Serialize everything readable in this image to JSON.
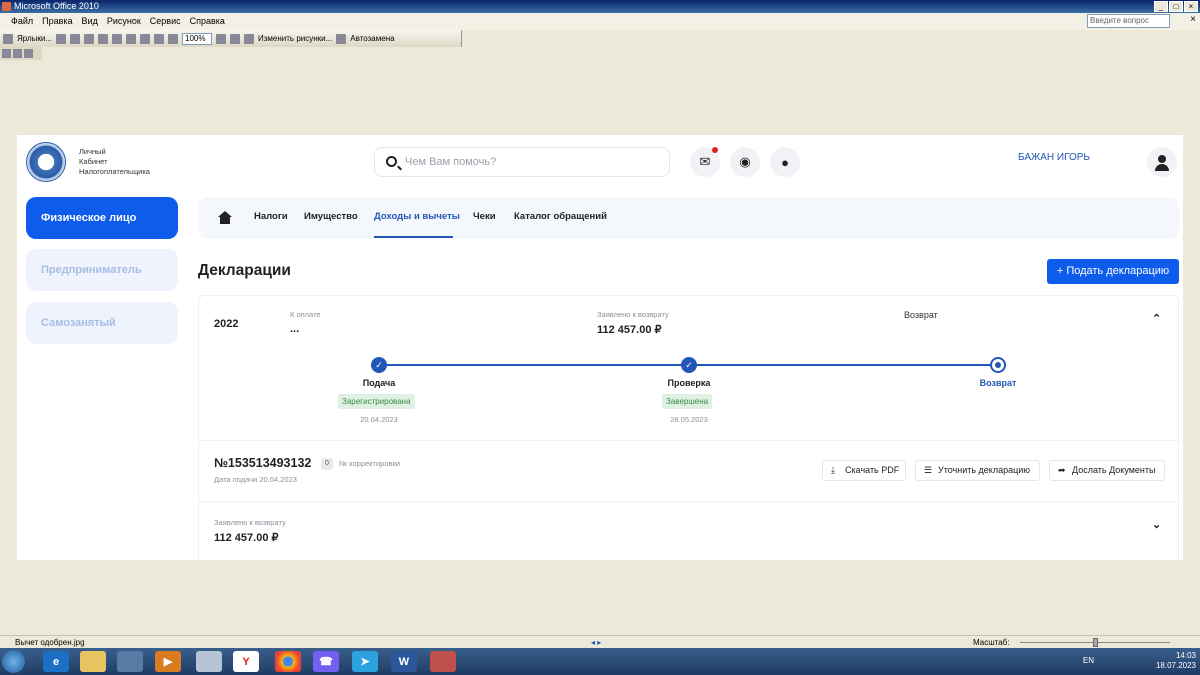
{
  "window": {
    "title": "Microsoft Office 2010",
    "ask_placeholder": "Введите вопрос"
  },
  "menu": [
    "Файл",
    "Правка",
    "Вид",
    "Рисунок",
    "Сервис",
    "Справка"
  ],
  "toolbar": {
    "shortcut_label": "Ярлыки...",
    "zoom": "100%",
    "edit_image_label": "Изменить рисунки...",
    "autoreplace_label": "Автозамена"
  },
  "site": {
    "brand_lines": [
      "Личный",
      "Кабинет",
      "Налогоплательщика"
    ],
    "search_placeholder": "Чем Вам помочь?",
    "user_name": "БАЖАН ИГОРЬ",
    "icons": [
      "mail-icon",
      "eye-off-icon",
      "bulb-icon",
      "user-icon",
      "search-icon",
      "home-icon"
    ]
  },
  "sidebar": {
    "items": [
      {
        "label": "Физическое лицо",
        "active": true
      },
      {
        "label": "Предприниматель",
        "active": false
      },
      {
        "label": "Самозанятый",
        "active": false
      }
    ]
  },
  "nav": {
    "tabs": [
      "Налоги",
      "Имущество",
      "Доходы и вычеты",
      "Чеки",
      "Каталог обращений"
    ],
    "active": "Доходы и вычеты"
  },
  "page": {
    "title": "Декларации",
    "submit_button": "Подать декларацию"
  },
  "declaration": {
    "year": "2022",
    "pay_label": "К оплате",
    "pay_value": "...",
    "claimed_label": "Заявлено к возврату",
    "claimed_value": "112 457.00 ₽",
    "refund_label": "Возврат",
    "steps": [
      {
        "name": "Подача",
        "status": "Зарегистрирована",
        "date": "20.04.2023"
      },
      {
        "name": "Проверка",
        "status": "Завершена",
        "date": "28.05.2023"
      },
      {
        "name": "Возврат",
        "status": "",
        "date": ""
      }
    ],
    "number": "№153513493132",
    "correction_count": "0",
    "correction_label": "№ корректировки",
    "file_date": "Дата подачи 20.04.2023",
    "actions": [
      "Скачать PDF",
      "Уточнить декларацию",
      "Дослать Документы"
    ],
    "footer_label": "Заявлено к возврату",
    "footer_value": "112 457.00 ₽"
  },
  "status": {
    "file": "Вычет одобрен.jpg",
    "zoom_label": "Масштаб:"
  },
  "taskbar": {
    "lang": "EN",
    "time": "14:03",
    "date": "18.07.2023"
  }
}
